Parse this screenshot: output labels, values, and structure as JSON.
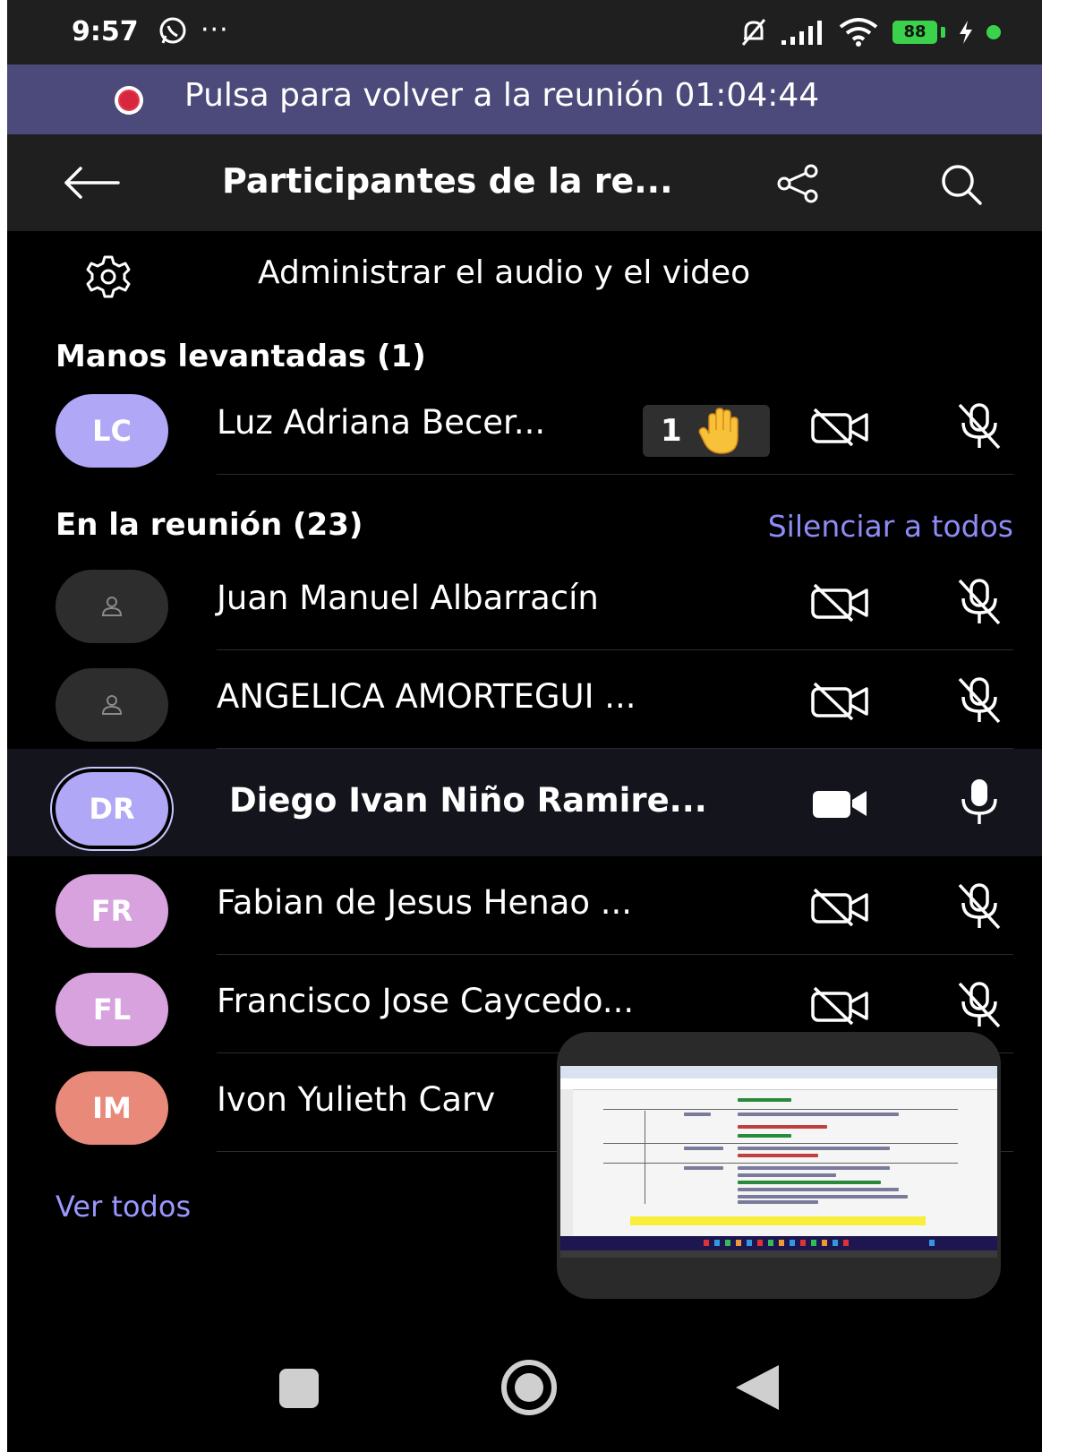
{
  "status_bar": {
    "time": "9:57",
    "dots": "···",
    "battery": "88"
  },
  "banner": {
    "text": "Pulsa para volver a la reunión 01:04:44"
  },
  "header": {
    "title": "Participantes de la re..."
  },
  "manage": {
    "label": "Administrar el audio y el video"
  },
  "raised_hands": {
    "title": "Manos levantadas (1)",
    "participants": [
      {
        "initials": "LC",
        "name": "Luz Adriana Becer...",
        "hand_count": "1",
        "avatar_color": "#b0a7f7"
      }
    ]
  },
  "in_meeting": {
    "title": "En la reunión (23)",
    "mute_all": "Silenciar a todos",
    "participants": [
      {
        "initials": "",
        "name": "Juan Manuel Albarracín",
        "avatar_color": "#2d2d2d"
      },
      {
        "initials": "",
        "name": "ANGELICA AMORTEGUI ...",
        "avatar_color": "#2d2d2d"
      },
      {
        "initials": "DR",
        "name": "Diego Ivan Niño Ramire...",
        "avatar_color": "#b0a7f7"
      },
      {
        "initials": "FR",
        "name": "Fabian de Jesus Henao ...",
        "avatar_color": "#d7a2dd"
      },
      {
        "initials": "FL",
        "name": "Francisco Jose Caycedo...",
        "avatar_color": "#d7a2dd"
      },
      {
        "initials": "IM",
        "name": "Ivon Yulieth Carv",
        "avatar_color": "#e9897a"
      }
    ]
  },
  "see_all": "Ver todos",
  "colors": {
    "accent": "#8e8bf5",
    "banner": "#4b4a7a",
    "recording": "#d7263d",
    "battery": "#3ad24b"
  }
}
